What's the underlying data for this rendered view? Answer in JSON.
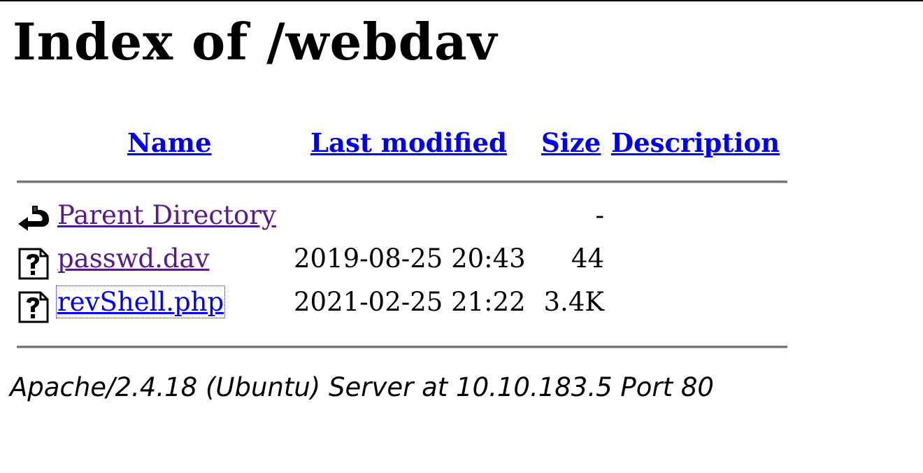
{
  "page": {
    "title": "Index of /webdav"
  },
  "table": {
    "headers": {
      "name": "Name",
      "last_modified": "Last modified",
      "size": "Size",
      "description": "Description"
    },
    "rows": [
      {
        "icon": "back-arrow-icon",
        "name": "Parent Directory",
        "modified": "",
        "size": "-",
        "description": ""
      },
      {
        "icon": "unknown-file-icon",
        "name": "passwd.dav",
        "modified": "2019-08-25 20:43",
        "size": "44",
        "description": ""
      },
      {
        "icon": "unknown-file-icon",
        "name": "revShell.php",
        "modified": "2021-02-25 21:22",
        "size": "3.4K",
        "description": ""
      }
    ]
  },
  "footer": {
    "server_signature": "Apache/2.4.18 (Ubuntu) Server at 10.10.183.5 Port 80"
  }
}
